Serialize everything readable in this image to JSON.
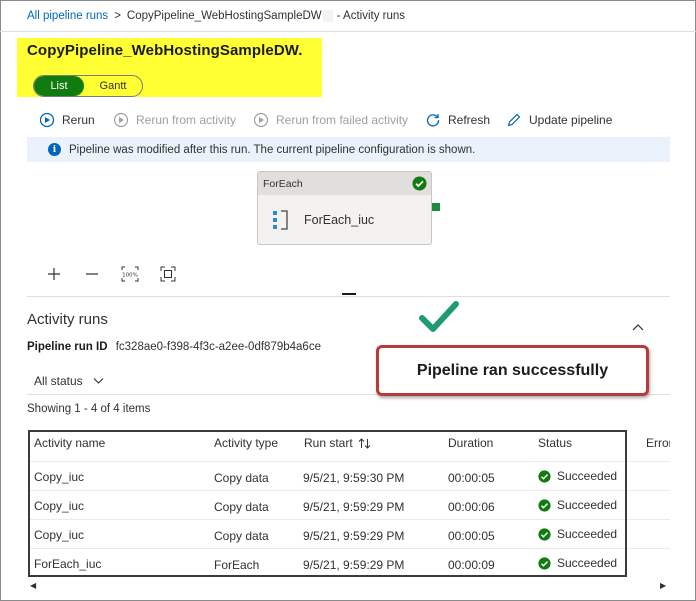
{
  "breadcrumb": {
    "root": "All pipeline runs",
    "separator": ">",
    "pipeline": "CopyPipeline_WebHostingSampleDW",
    "current": "- Activity runs"
  },
  "header": {
    "title": "CopyPipeline_WebHostingSampleDW.",
    "view_toggle": {
      "list": "List",
      "gantt": "Gantt",
      "selected": "List"
    }
  },
  "toolbar": {
    "rerun": "Rerun",
    "rerun_from_activity": "Rerun from activity",
    "rerun_from_failed": "Rerun from failed activity",
    "refresh": "Refresh",
    "update_pipeline": "Update pipeline"
  },
  "info_bar": {
    "icon": "info-icon",
    "text": "Pipeline was modified after this run. The current pipeline configuration is shown."
  },
  "canvas": {
    "node_type": "ForEach",
    "node_name": "ForEach_iuc",
    "zoom_fit_label": "100%"
  },
  "activity_runs": {
    "title": "Activity runs",
    "run_id_label": "Pipeline run ID",
    "run_id": "fc328ae0-f398-4f3c-a2ee-0df879b4a6ce",
    "status_filter": "All status",
    "showing": "Showing 1 - 4 of 4 items",
    "columns": [
      "Activity name",
      "Activity type",
      "Run start",
      "Duration",
      "Status",
      "Error"
    ],
    "rows": [
      {
        "name": "Copy_iuc",
        "type": "Copy data",
        "run_start": "9/5/21, 9:59:30 PM",
        "duration": "00:00:05",
        "status": "Succeeded"
      },
      {
        "name": "Copy_iuc",
        "type": "Copy data",
        "run_start": "9/5/21, 9:59:29 PM",
        "duration": "00:00:06",
        "status": "Succeeded"
      },
      {
        "name": "Copy_iuc",
        "type": "Copy data",
        "run_start": "9/5/21, 9:59:29 PM",
        "duration": "00:00:05",
        "status": "Succeeded"
      },
      {
        "name": "ForEach_iuc",
        "type": "ForEach",
        "run_start": "9/5/21, 9:59:29 PM",
        "duration": "00:00:09",
        "status": "Succeeded"
      }
    ]
  },
  "callout": {
    "text": "Pipeline ran successfully"
  },
  "colors": {
    "accent": "#0067b8",
    "success": "#107c10",
    "highlight": "#ffff33",
    "callout_border": "#b83a3a"
  }
}
